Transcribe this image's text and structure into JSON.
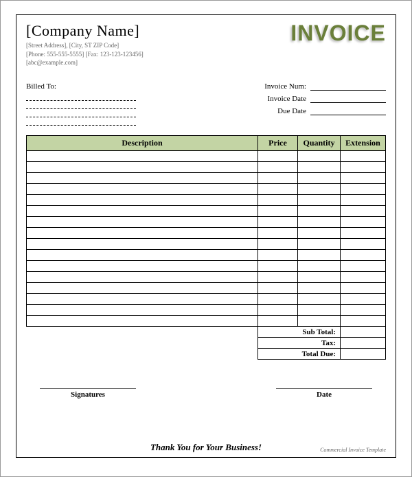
{
  "header": {
    "company_name": "[Company Name]",
    "address_line": "[Street Address], [City, ST ZIP Code]",
    "phone_line": "[Phone: 555-555-5555] [Fax: 123-123-123456]",
    "email_line": "[abc@example.com]",
    "invoice_title": "INVOICE"
  },
  "billed_to": {
    "label": "Billed To:",
    "lines": [
      "",
      "",
      "",
      ""
    ]
  },
  "meta": {
    "invoice_num": {
      "label": "Invoice Num:",
      "value": ""
    },
    "invoice_date": {
      "label": "Invoice Date",
      "value": ""
    },
    "due_date": {
      "label": "Due Date",
      "value": ""
    }
  },
  "table": {
    "headers": [
      "Description",
      "Price",
      "Quantity",
      "Extension"
    ],
    "rows": [
      [
        "",
        "",
        "",
        ""
      ],
      [
        "",
        "",
        "",
        ""
      ],
      [
        "",
        "",
        "",
        ""
      ],
      [
        "",
        "",
        "",
        ""
      ],
      [
        "",
        "",
        "",
        ""
      ],
      [
        "",
        "",
        "",
        ""
      ],
      [
        "",
        "",
        "",
        ""
      ],
      [
        "",
        "",
        "",
        ""
      ],
      [
        "",
        "",
        "",
        ""
      ],
      [
        "",
        "",
        "",
        ""
      ],
      [
        "",
        "",
        "",
        ""
      ],
      [
        "",
        "",
        "",
        ""
      ],
      [
        "",
        "",
        "",
        ""
      ],
      [
        "",
        "",
        "",
        ""
      ],
      [
        "",
        "",
        "",
        ""
      ],
      [
        "",
        "",
        "",
        ""
      ]
    ]
  },
  "totals": {
    "subtotal": {
      "label": "Sub Total:",
      "value": ""
    },
    "tax": {
      "label": "Tax:",
      "value": ""
    },
    "total_due": {
      "label": "Total Due:",
      "value": ""
    }
  },
  "signatures": {
    "left": "Signatures",
    "right": "Date"
  },
  "footer": {
    "thanks": "Thank You for Your Business!",
    "template_tag": "Commercial Invoice Template"
  }
}
